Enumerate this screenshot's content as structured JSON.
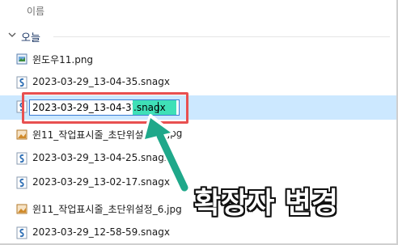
{
  "column_header": "이름",
  "group": {
    "label": "오늘"
  },
  "files": [
    {
      "name": "윈도우11.png",
      "type": "png"
    },
    {
      "name": "2023-03-29_13-04-35.snagx",
      "type": "snagx"
    },
    {
      "name": "2023-03-29_13-04-37.snagx",
      "type": "snagx",
      "selected": true
    },
    {
      "name": "윈11_작업표시줄_초단위설",
      "suffix": ".jpg",
      "type": "jpg"
    },
    {
      "name": "2023-03-29_13-04-25.snagx",
      "type": "snagx"
    },
    {
      "name": "2023-03-29_13-02-17.snagx",
      "type": "snagx"
    },
    {
      "name": "윈11_작업표시줄_초단위설정_6.jpg",
      "type": "jpg"
    },
    {
      "name": "2023-03-29_12-58-59.snagx",
      "type": "snagx"
    }
  ],
  "rename": {
    "base": "2023-03-29_13-04-37",
    "ext": ".snagx"
  },
  "annotation": {
    "caption": "확장자 변경",
    "arrow_color": "#1fa88a",
    "box_color": "#e85050"
  },
  "colors": {
    "selected_row": "#cce8ff",
    "ext_highlight": "#3fe0b7",
    "group_label": "#1e3a68"
  }
}
